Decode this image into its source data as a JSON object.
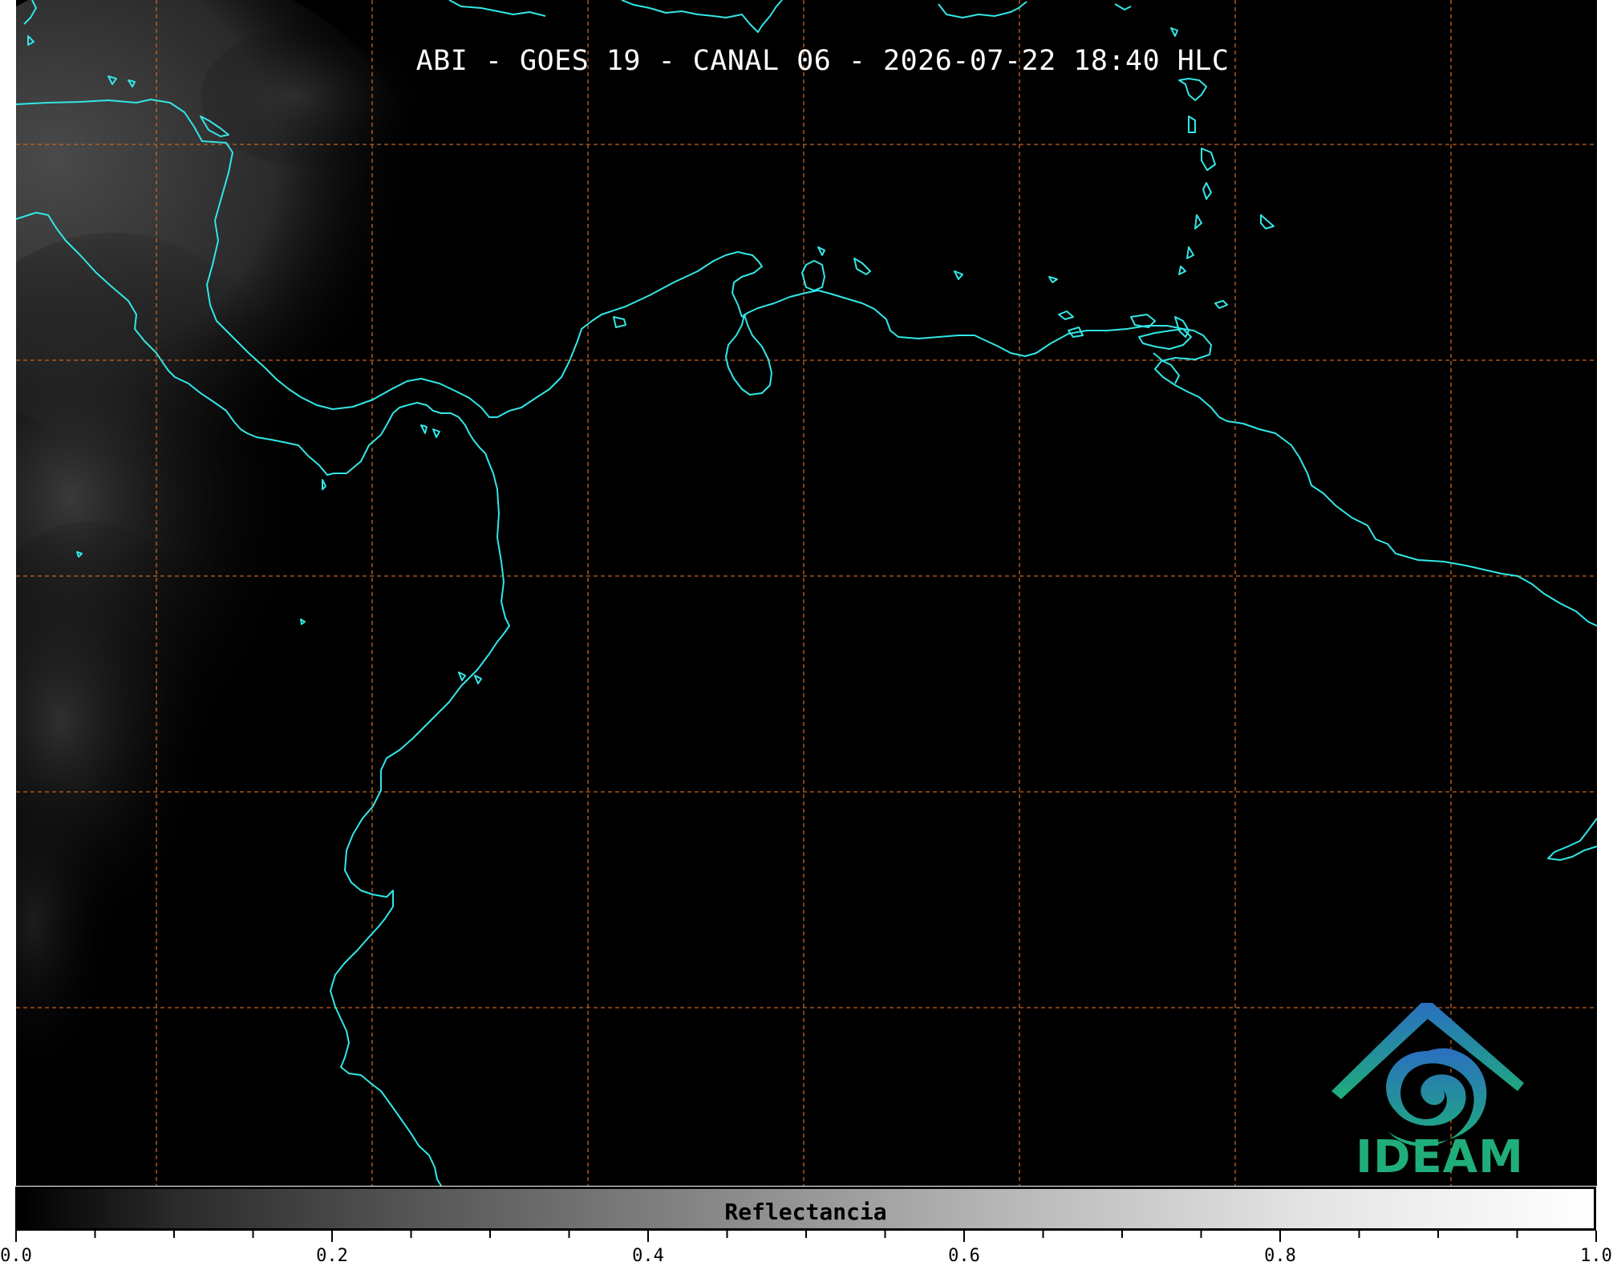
{
  "title": "ABI - GOES 19 - CANAL 06 - 2026-07-22 18:40 HLC",
  "colorbar": {
    "label": "Reflectancia",
    "range": [
      0.0,
      1.0
    ],
    "major_ticks": [
      "0.0",
      "0.2",
      "0.4",
      "0.6",
      "0.8",
      "1.0"
    ],
    "minor_step": 0.05
  },
  "colors": {
    "background": "#000000",
    "coastline": "#33e6e6",
    "gridlines": "#c8641e",
    "logo_blue": "#2a7fc0",
    "logo_green": "#1fae7a"
  },
  "map": {
    "gridlines": "dashed",
    "has_cloud_texture_west": true
  },
  "logo": {
    "text": "IDEAM",
    "icon": "ideam-logo-icon"
  }
}
